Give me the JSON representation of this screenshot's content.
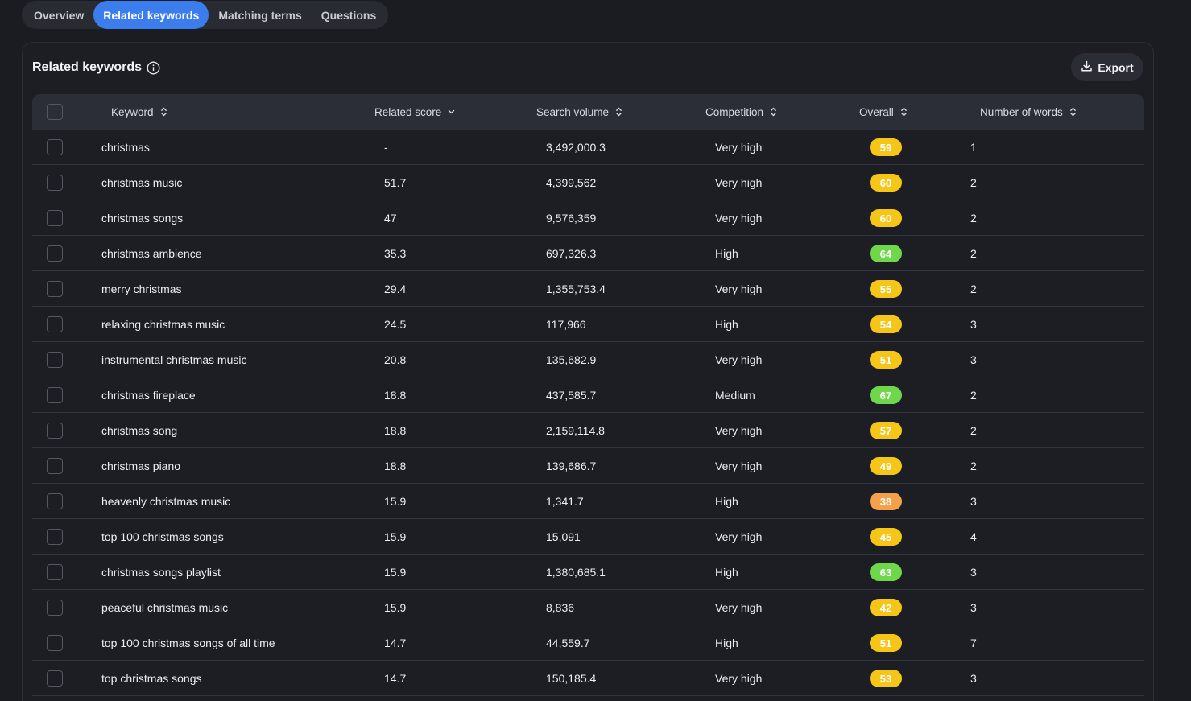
{
  "tabs": [
    {
      "label": "Overview",
      "active": false
    },
    {
      "label": "Related keywords",
      "active": true
    },
    {
      "label": "Matching terms",
      "active": false
    },
    {
      "label": "Questions",
      "active": false
    }
  ],
  "panel": {
    "title": "Related keywords",
    "info_icon": "info-circle-icon",
    "export_label": "Export",
    "export_icon": "download-icon"
  },
  "table": {
    "columns": [
      "Keyword",
      "Related score",
      "Search volume",
      "Competition",
      "Overall",
      "Number of words"
    ],
    "sort_icons": [
      "sort-updown-icon",
      "chevron-down-icon",
      "sort-updown-icon",
      "sort-updown-icon",
      "sort-updown-icon",
      "sort-updown-icon"
    ],
    "rows": [
      {
        "keyword": "christmas",
        "score": "-",
        "volume": "3,492,000.3",
        "competition": "Very high",
        "overall": "59",
        "words": "1"
      },
      {
        "keyword": "christmas music",
        "score": "51.7",
        "volume": "4,399,562",
        "competition": "Very high",
        "overall": "60",
        "words": "2"
      },
      {
        "keyword": "christmas songs",
        "score": "47",
        "volume": "9,576,359",
        "competition": "Very high",
        "overall": "60",
        "words": "2"
      },
      {
        "keyword": "christmas ambience",
        "score": "35.3",
        "volume": "697,326.3",
        "competition": "High",
        "overall": "64",
        "words": "2"
      },
      {
        "keyword": "merry christmas",
        "score": "29.4",
        "volume": "1,355,753.4",
        "competition": "Very high",
        "overall": "55",
        "words": "2"
      },
      {
        "keyword": "relaxing christmas music",
        "score": "24.5",
        "volume": "117,966",
        "competition": "High",
        "overall": "54",
        "words": "3"
      },
      {
        "keyword": "instrumental christmas music",
        "score": "20.8",
        "volume": "135,682.9",
        "competition": "Very high",
        "overall": "51",
        "words": "3"
      },
      {
        "keyword": "christmas fireplace",
        "score": "18.8",
        "volume": "437,585.7",
        "competition": "Medium",
        "overall": "67",
        "words": "2"
      },
      {
        "keyword": "christmas song",
        "score": "18.8",
        "volume": "2,159,114.8",
        "competition": "Very high",
        "overall": "57",
        "words": "2"
      },
      {
        "keyword": "christmas piano",
        "score": "18.8",
        "volume": "139,686.7",
        "competition": "Very high",
        "overall": "49",
        "words": "2"
      },
      {
        "keyword": "heavenly christmas music",
        "score": "15.9",
        "volume": "1,341.7",
        "competition": "High",
        "overall": "38",
        "words": "3"
      },
      {
        "keyword": "top 100 christmas songs",
        "score": "15.9",
        "volume": "15,091",
        "competition": "Very high",
        "overall": "45",
        "words": "4"
      },
      {
        "keyword": "christmas songs playlist",
        "score": "15.9",
        "volume": "1,380,685.1",
        "competition": "High",
        "overall": "63",
        "words": "3"
      },
      {
        "keyword": "peaceful christmas music",
        "score": "15.9",
        "volume": "8,836",
        "competition": "Very high",
        "overall": "42",
        "words": "3"
      },
      {
        "keyword": "top 100 christmas songs of all time",
        "score": "14.7",
        "volume": "44,559.7",
        "competition": "High",
        "overall": "51",
        "words": "7"
      },
      {
        "keyword": "top christmas songs",
        "score": "14.7",
        "volume": "150,185.4",
        "competition": "Very high",
        "overall": "53",
        "words": "3"
      }
    ]
  },
  "colors": {
    "accent": "#3b7ded",
    "badge_yellow": "#f5c518",
    "badge_green": "#6fd84a",
    "badge_orange": "#f5a04a"
  }
}
